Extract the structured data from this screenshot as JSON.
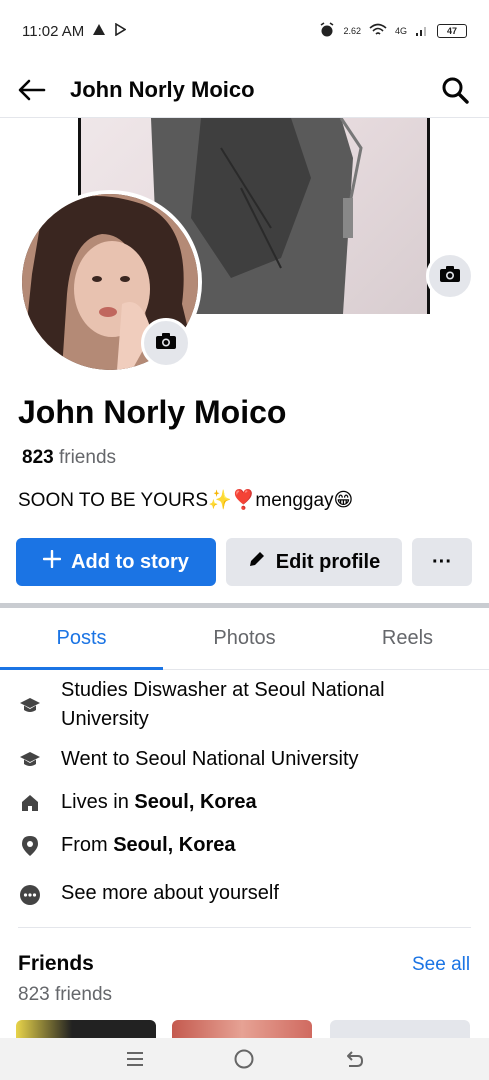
{
  "status": {
    "time": "11:02 AM",
    "speed": "2.62",
    "network": "4G",
    "battery": "47"
  },
  "header": {
    "title": "John Norly Moico"
  },
  "profile": {
    "name": "John Norly Moico",
    "friend_count": "823",
    "friend_word": "friends",
    "bio": "SOON TO BE YOURS✨❣️menggay😁"
  },
  "actions": {
    "add_story": "Add to story",
    "edit_profile": "Edit profile",
    "more": "···"
  },
  "tabs": [
    {
      "label": "Posts",
      "active": true
    },
    {
      "label": "Photos",
      "active": false
    },
    {
      "label": "Reels",
      "active": false
    }
  ],
  "details": {
    "studies": "Studies Diswasher at Seoul National University",
    "went_to": "Went to Seoul National University",
    "lives_prefix": "Lives in ",
    "lives_place": "Seoul, Korea",
    "from_prefix": "From ",
    "from_place": "Seoul, Korea",
    "see_more": "See more about yourself"
  },
  "friends": {
    "title": "Friends",
    "see_all": "See all",
    "subtitle": "823 friends"
  },
  "colors": {
    "accent": "#1b74e4",
    "secondary_btn": "#e4e6eb",
    "muted_text": "#65676b"
  },
  "icons": {
    "back": "back-arrow-icon",
    "search": "search-icon",
    "camera": "camera-icon",
    "education": "graduation-cap-icon",
    "home": "home-icon",
    "location": "location-pin-icon",
    "more": "more-dots-icon"
  }
}
